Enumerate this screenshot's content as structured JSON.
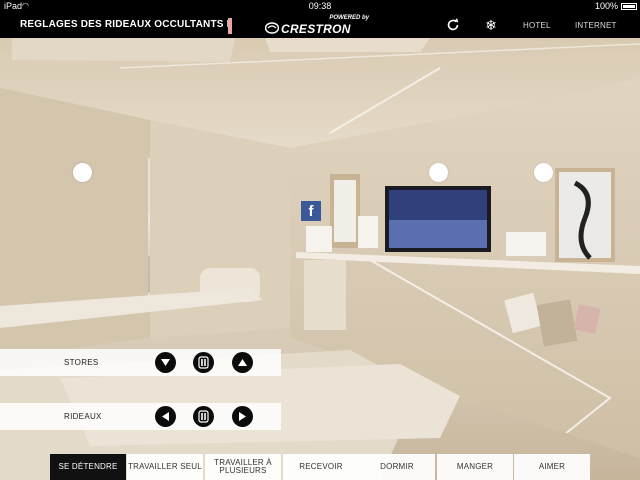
{
  "status_bar": {
    "device": "iPad",
    "time": "09:38",
    "battery": "100%"
  },
  "header": {
    "title": "REGLAGES DES RIDEAUX OCCULTANTS E",
    "brand_powered": "POWERED by",
    "brand_name": "CRESTRON",
    "refresh_icon": "refresh-icon",
    "climate_icon": "snowflake-icon",
    "nav": [
      "HOTEL",
      "INTERNET"
    ]
  },
  "room": {
    "facebook_glyph": "f"
  },
  "controls": {
    "stores": {
      "label": "STORES",
      "buttons": [
        "down-arrow-icon",
        "pause-icon",
        "up-arrow-icon"
      ]
    },
    "rideaux": {
      "label": "RIDEAUX",
      "buttons": [
        "left-arrow-icon",
        "pause-icon",
        "right-arrow-icon"
      ]
    }
  },
  "tabs": [
    {
      "label": "SE DÉTENDRE",
      "active": true
    },
    {
      "label": "TRAVAILLER SEUL",
      "active": false
    },
    {
      "label": "TRAVAILLER À PLUSIEURS",
      "active": false
    },
    {
      "label": "RECEVOIR",
      "active": false
    },
    {
      "label": "DORMIR",
      "active": false
    },
    {
      "label": "MANGER",
      "active": false
    },
    {
      "label": "AIMER",
      "active": false
    }
  ],
  "colors": {
    "header_bg": "#000000",
    "active_tab_bg": "#111111",
    "wood": "#d8cbb7",
    "button_black": "#0b0b0b"
  }
}
